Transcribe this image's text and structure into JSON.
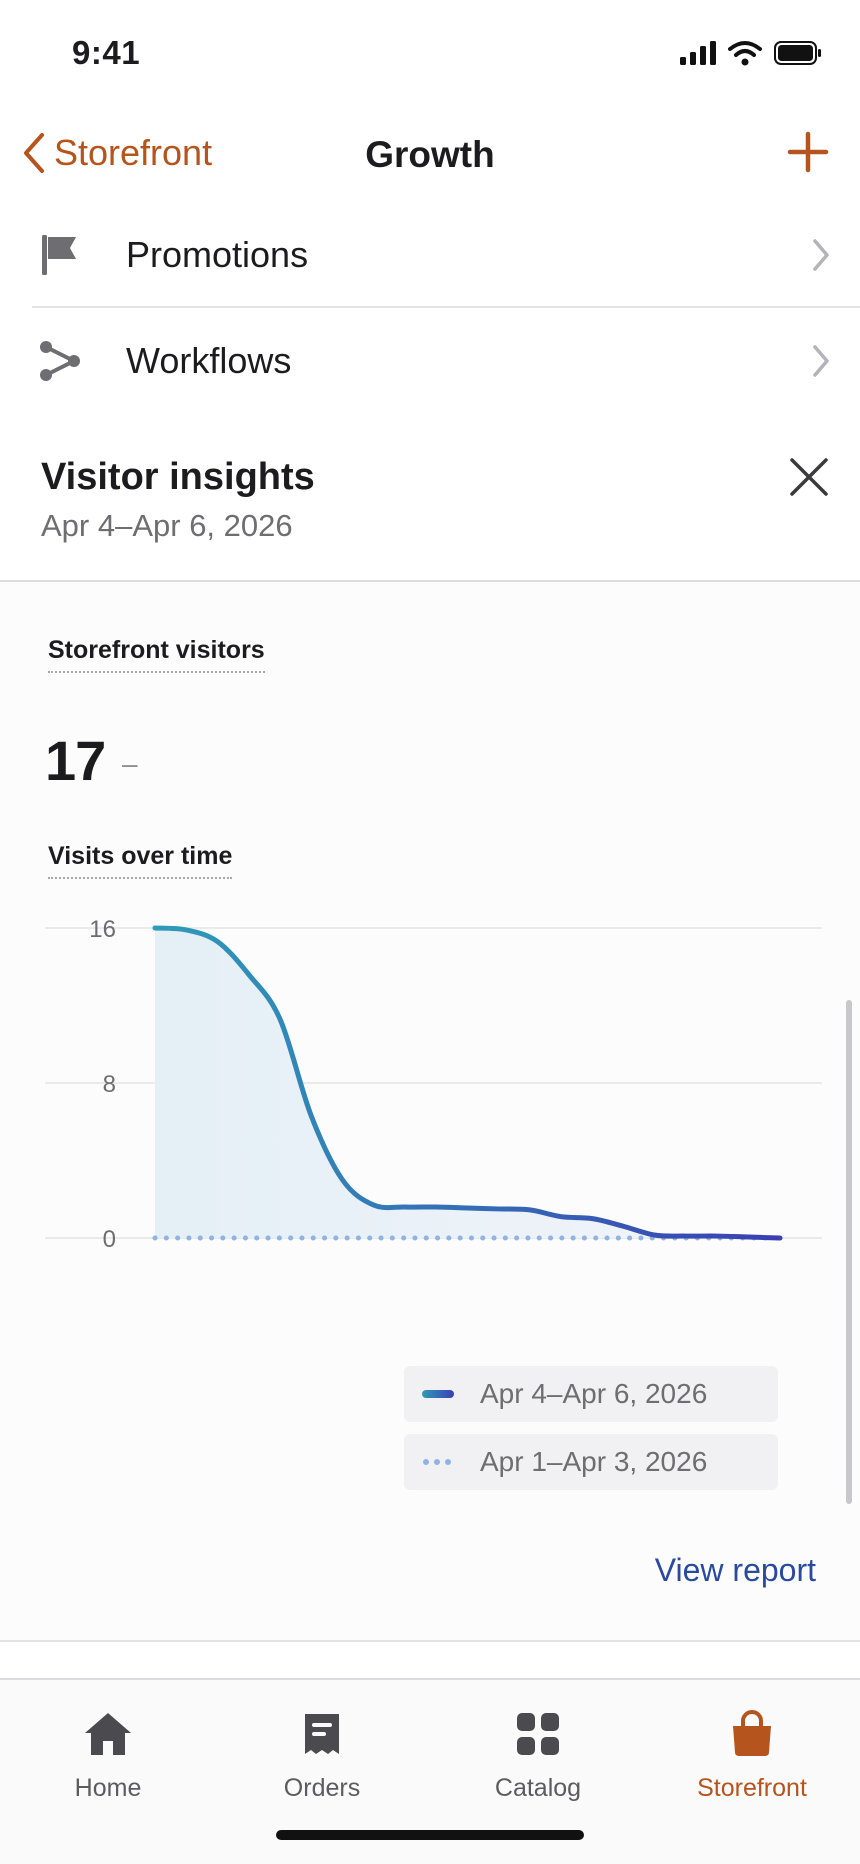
{
  "status_bar": {
    "time": "9:41"
  },
  "nav": {
    "back_label": "Storefront",
    "title": "Growth"
  },
  "menu": {
    "items": [
      {
        "label": "Promotions",
        "icon": "flag-icon"
      },
      {
        "label": "Workflows",
        "icon": "workflow-icon"
      }
    ]
  },
  "insights": {
    "title": "Visitor insights",
    "date_range": "Apr 4–Apr 6, 2026",
    "metric_label": "Storefront visitors",
    "metric_value": "17",
    "metric_change": "–",
    "chart_label": "Visits over time",
    "view_report": "View report"
  },
  "chart_data": {
    "type": "line",
    "title": "Visits over time",
    "xlabel": "",
    "ylabel": "",
    "ylim": [
      0,
      16
    ],
    "y_ticks": [
      "16",
      "8",
      "0"
    ],
    "grid": true,
    "legend_position": "bottom-right",
    "series": [
      {
        "name": "Apr 4–Apr 6, 2026",
        "style": "solid",
        "color_start": "#2f9bb8",
        "color_end": "#3a3fb3",
        "x": [
          0,
          0.05,
          0.1,
          0.15,
          0.2,
          0.25,
          0.3,
          0.35,
          0.4,
          0.45,
          0.5,
          0.55,
          0.6,
          0.65,
          0.7,
          0.75,
          0.8,
          0.85,
          0.9,
          0.95,
          1.0
        ],
        "values": [
          16,
          15.9,
          15.3,
          13.6,
          11.3,
          6.3,
          3.0,
          1.7,
          1.6,
          1.6,
          1.55,
          1.5,
          1.45,
          1.1,
          1.0,
          0.6,
          0.15,
          0.1,
          0.1,
          0.05,
          0
        ]
      },
      {
        "name": "Apr 1–Apr 3, 2026",
        "style": "dotted",
        "color": "#8fb3e3",
        "x": [
          0,
          1.0
        ],
        "values": [
          0,
          0
        ]
      }
    ]
  },
  "tabs": [
    {
      "label": "Home",
      "icon": "home-icon",
      "active": false
    },
    {
      "label": "Orders",
      "icon": "orders-icon",
      "active": false
    },
    {
      "label": "Catalog",
      "icon": "catalog-icon",
      "active": false
    },
    {
      "label": "Storefront",
      "icon": "shopping-bag-icon",
      "active": true
    }
  ],
  "colors": {
    "accent": "#b5541c",
    "link": "#2a4aa0",
    "text": "#1c1c1e",
    "muted": "#6d6d72"
  }
}
